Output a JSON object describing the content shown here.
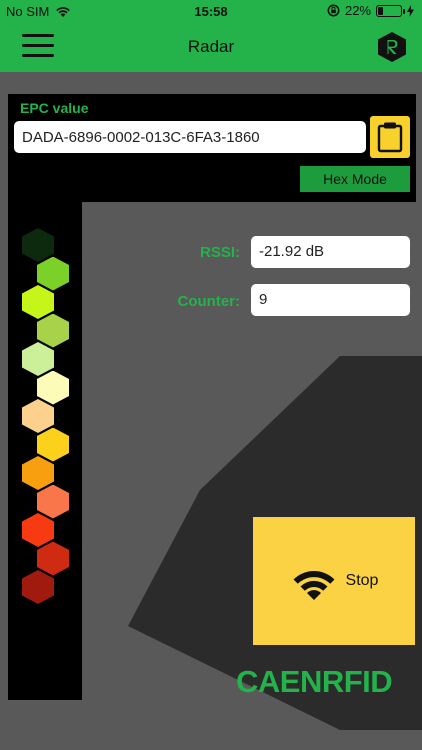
{
  "status_bar": {
    "carrier": "No SIM",
    "time": "15:58",
    "battery_percent": "22%",
    "battery_level": 0.22
  },
  "nav": {
    "title": "Radar"
  },
  "epc": {
    "label": "EPC value",
    "value": "DADA-6896-0002-013C-6FA3-1860",
    "hex_mode_label": "Hex Mode"
  },
  "fields": {
    "rssi_label": "RSSI:",
    "rssi_value": "-21.92 dB",
    "counter_label": "Counter:",
    "counter_value": "9"
  },
  "stop_button": {
    "label": "Stop"
  },
  "brand": {
    "text": "CAENRFID"
  },
  "meter": {
    "colors": [
      "#0e2a0e",
      "#7bd128",
      "#c6f519",
      "#a8d24a",
      "#ccf09a",
      "#fcfcb8",
      "#fbd18d",
      "#fbd11c",
      "#f89f10",
      "#f8764a",
      "#f83a12",
      "#cf2b12",
      "#a01a0e"
    ]
  },
  "colors": {
    "accent_green": "#24b24a",
    "stop_yellow": "#fbd243"
  }
}
